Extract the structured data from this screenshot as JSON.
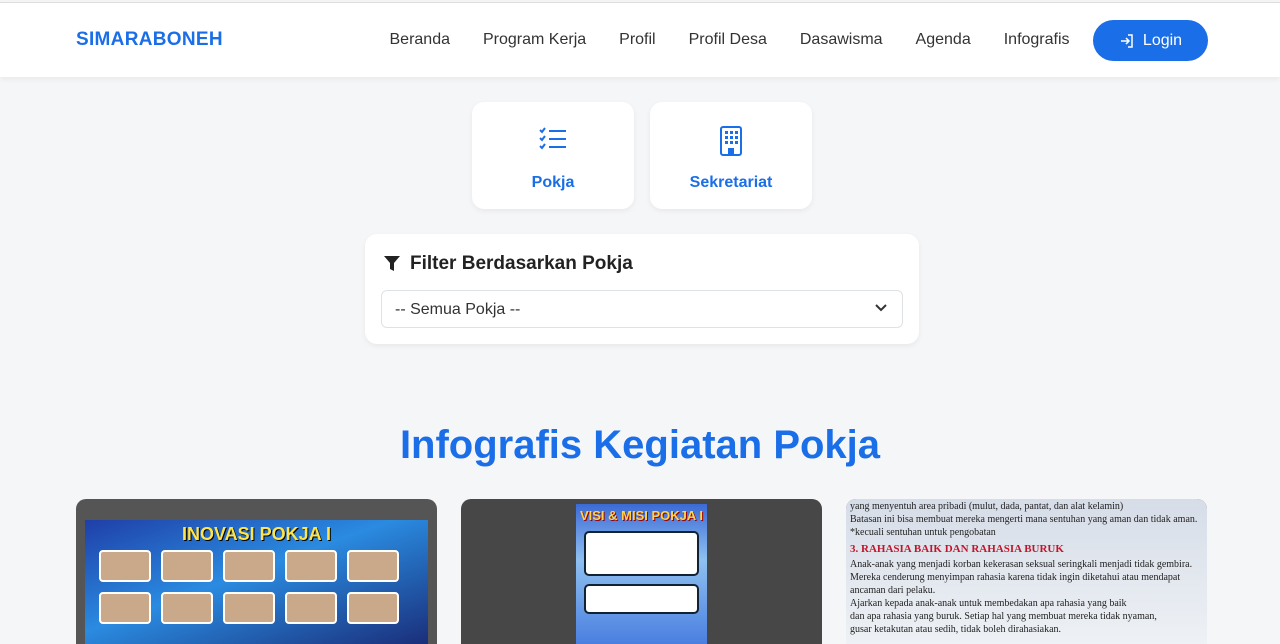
{
  "brand": "SIMARABONEH",
  "nav": {
    "items": [
      "Beranda",
      "Program Kerja",
      "Profil",
      "Profil Desa",
      "Dasawisma",
      "Agenda",
      "Infografis"
    ],
    "login": "Login"
  },
  "categories": [
    {
      "label": "Pokja",
      "icon": "checklist-icon"
    },
    {
      "label": "Sekretariat",
      "icon": "building-icon"
    }
  ],
  "filter": {
    "title": "Filter Berdasarkan Pokja",
    "selected": "-- Semua Pokja --"
  },
  "section_title": "Infografis Kegiatan Pokja",
  "infographics": [
    {
      "title": "INOVASI POKJA I"
    },
    {
      "title": "VISI & MISI POKJA I"
    },
    {
      "heading": "3. RAHASIA BAIK DAN RAHASIA BURUK",
      "lines": [
        "yang menyentuh area pribadi (mulut, dada, pantat, dan alat kelamin)",
        "Batasan ini bisa membuat mereka mengerti mana sentuhan yang aman dan tidak aman.",
        "*kecuali sentuhan untuk pengobatan"
      ],
      "body": [
        "Anak-anak yang menjadi korban kekerasan seksual seringkali menjadi tidak gembira.",
        "Mereka cenderung menyimpan rahasia karena tidak ingin diketahui atau mendapat",
        "ancaman dari pelaku.",
        "Ajarkan kepada anak-anak untuk membedakan apa rahasia yang baik",
        "dan apa rahasia yang buruk. Setiap hal yang membuat mereka tidak nyaman,",
        "gusar ketakutan atau sedih, tidak boleh dirahasiakan."
      ]
    }
  ]
}
